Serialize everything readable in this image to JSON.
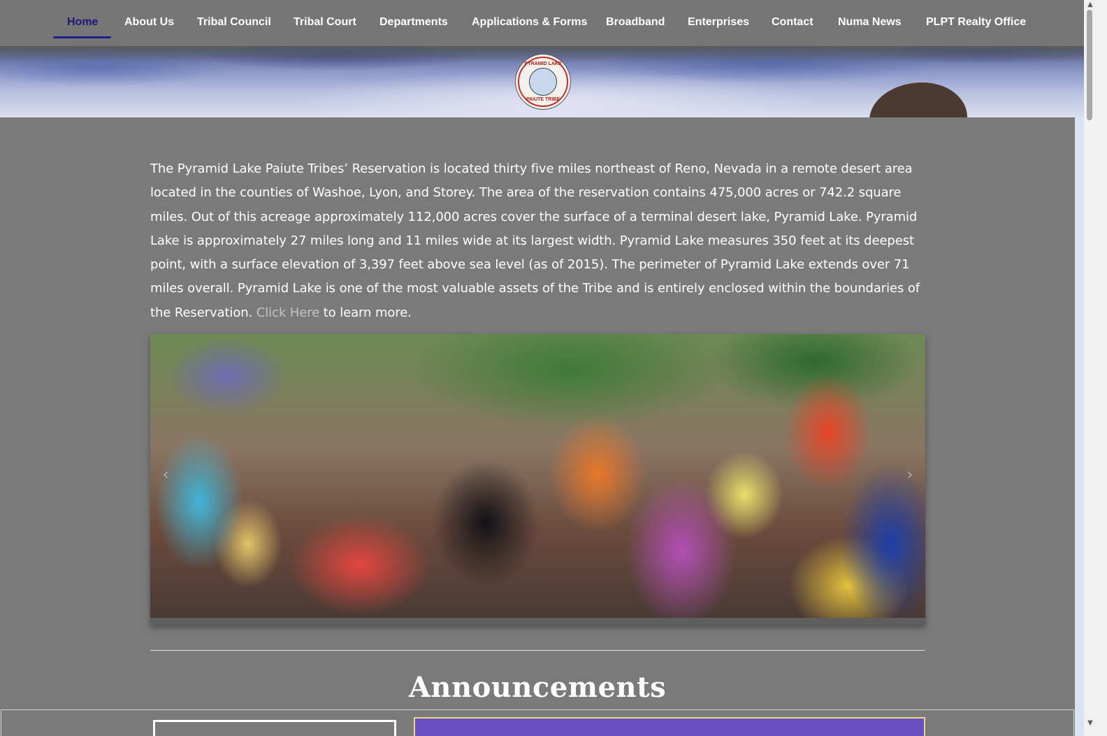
{
  "nav": {
    "items": [
      {
        "label": "Home",
        "active": true
      },
      {
        "label": "About Us"
      },
      {
        "label": "Tribal Council"
      },
      {
        "label": "Tribal Court"
      },
      {
        "label": "Departments"
      },
      {
        "label": "Applications & Forms"
      },
      {
        "label": "Broadband"
      },
      {
        "label": "Enterprises"
      },
      {
        "label": "Contact"
      },
      {
        "label": "Numa News"
      },
      {
        "label": "PLPT Realty Office"
      }
    ],
    "active_color": "#1a1a7a"
  },
  "hero": {
    "seal": {
      "top_text": "PYRAMID LAKE",
      "bottom_text": "PAIUTE TRIBE"
    }
  },
  "intro": {
    "text": "The Pyramid Lake Paiute Tribes’ Reservation is located thirty five miles northeast of Reno, Nevada in a remote desert area located in the counties of Washoe, Lyon, and Storey. The area of the reservation contains 475,000 acres or 742.2 square miles. Out of this acreage approximately 112,000 acres cover the surface of a terminal desert lake, Pyramid Lake. Pyramid Lake is approximately 27 miles long and 11 miles wide at its largest width. Pyramid Lake measures 350 feet at its deepest point, with a surface elevation of 3,397 feet above sea level (as of 2015). The perimeter of Pyramid Lake extends over 71 miles overall. Pyramid Lake is one of the most valuable assets of the Tribe and is entirely enclosed within the boundaries of the Reservation.",
    "link_text": "Click Here",
    "after_link": "to learn more."
  },
  "carousel": {
    "prev_icon": "chevron-left-icon",
    "next_icon": "chevron-right-icon",
    "prev_glyph": "‹",
    "next_glyph": "›"
  },
  "announcements": {
    "title": "Announcements"
  },
  "scrollbar": {
    "up_glyph": "▲",
    "down_glyph": "▼"
  },
  "colors": {
    "page_bg": "#7a7a7a",
    "nav_bg": "#767676",
    "link": "#c4c4c4",
    "announcement_card": "#6a4fc0"
  }
}
